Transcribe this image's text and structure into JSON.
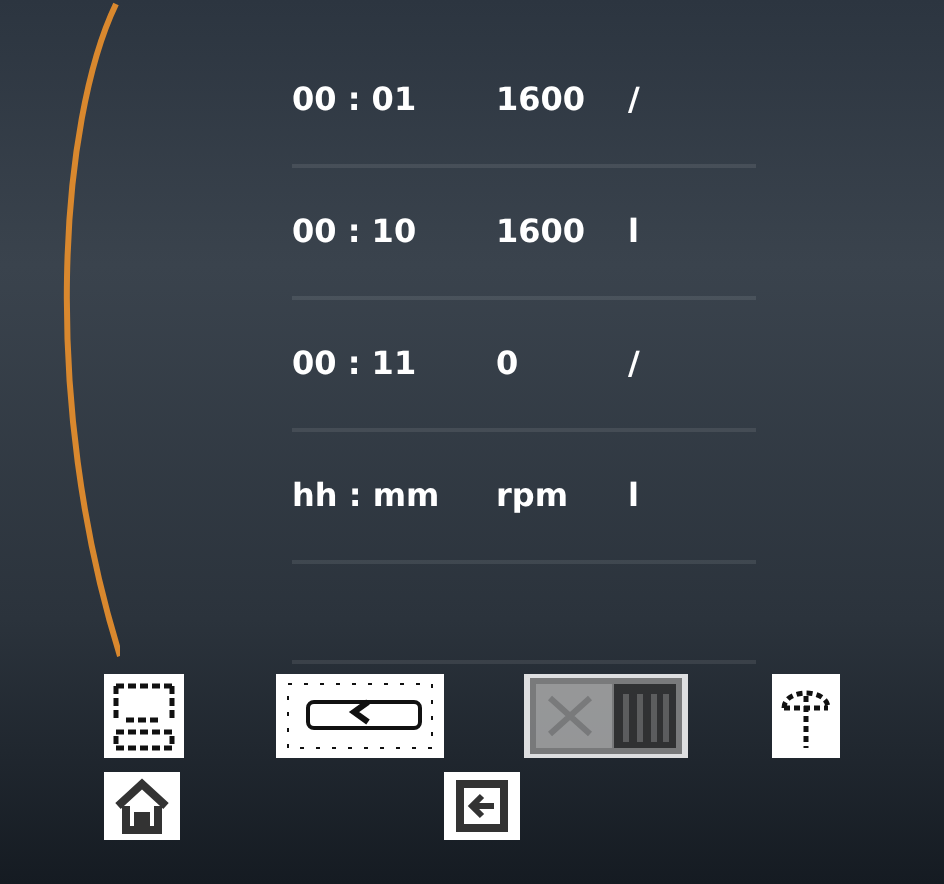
{
  "program": [
    {
      "time": "00 : 01",
      "speed": "1600",
      "direction": "/"
    },
    {
      "time": "00 : 10",
      "speed": "1600",
      "direction": "l"
    },
    {
      "time": "00 : 11",
      "speed": "0",
      "direction": "/"
    },
    {
      "time": "hh : mm",
      "speed": "rpm",
      "direction": "l"
    }
  ],
  "toolbar": [
    {
      "kind": "grid",
      "disabled": false
    },
    {
      "kind": "back",
      "disabled": false
    },
    {
      "kind": "clear",
      "disabled": true
    },
    {
      "kind": "tools",
      "disabled": false
    }
  ],
  "nav": [
    {
      "kind": "home"
    },
    {
      "kind": "exit"
    }
  ]
}
